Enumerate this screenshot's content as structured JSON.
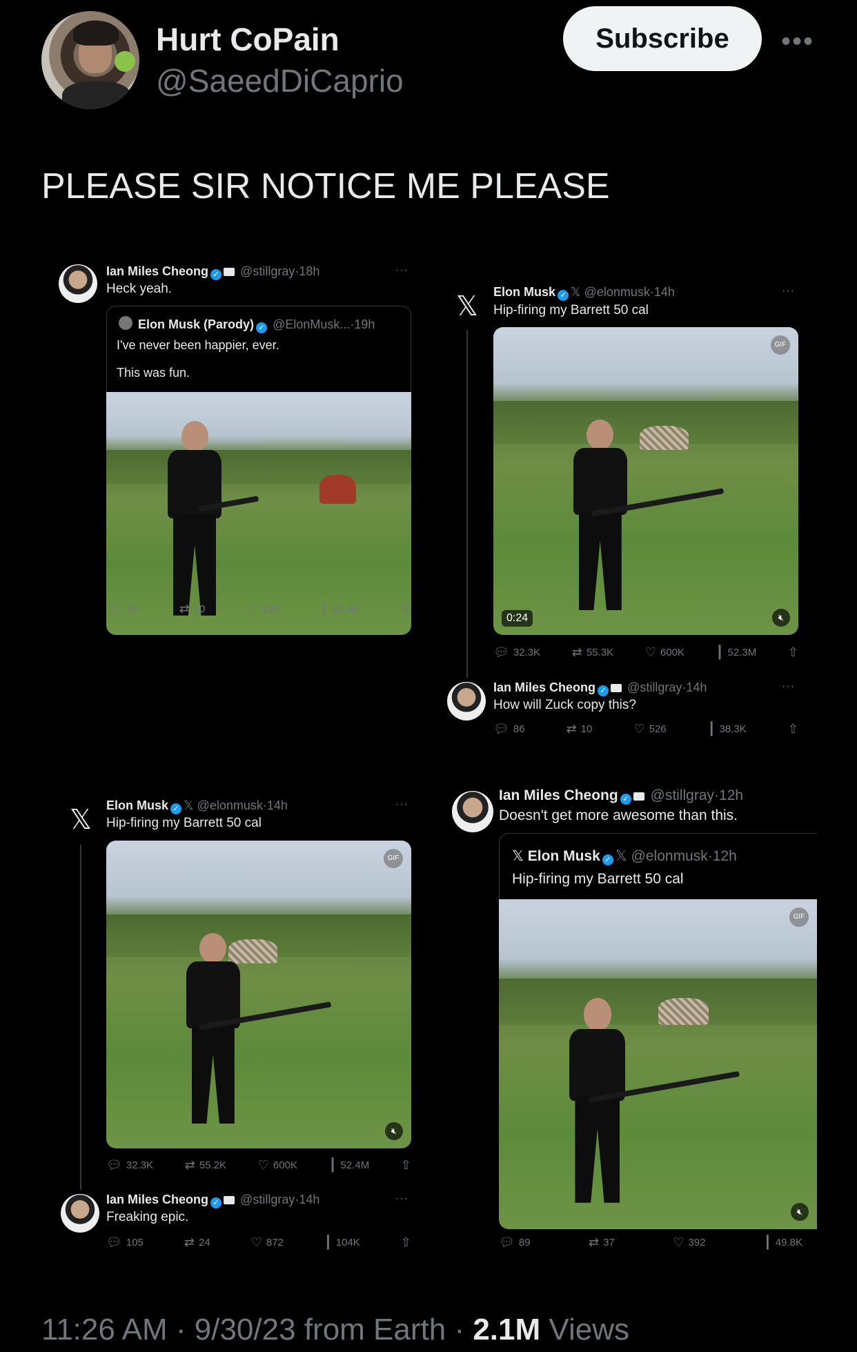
{
  "author": {
    "name": "Hurt CoPain",
    "handle": "@SaeedDiCaprio",
    "subscribe_label": "Subscribe",
    "more_icon": "more-horizontal-icon"
  },
  "tweet_text": "PLEASE SIR NOTICE ME PLEASE",
  "panels": {
    "top_left": {
      "author": "Ian Miles Cheong",
      "handle": "@stillgray",
      "time": "18h",
      "text": "Heck yeah.",
      "quote": {
        "author": "Elon Musk (Parody)",
        "handle": "@ElonMusk...",
        "time": "19h",
        "line1": "I've never been happier, ever.",
        "line2": "This was fun."
      },
      "stats": {
        "replies": "28",
        "reposts": "10",
        "likes": "129",
        "views": "22.4K"
      }
    },
    "top_right": {
      "author": "Elon Musk",
      "handle": "@elonmusk",
      "time": "14h",
      "text": "Hip-firing my Barrett 50 cal",
      "video_time": "0:24",
      "stats": {
        "replies": "32.3K",
        "reposts": "55.3K",
        "likes": "600K",
        "views": "52.3M"
      },
      "reply": {
        "author": "Ian Miles Cheong",
        "handle": "@stillgray",
        "time": "14h",
        "text": "How will Zuck copy this?",
        "stats": {
          "replies": "86",
          "reposts": "10",
          "likes": "526",
          "views": "38.3K"
        }
      }
    },
    "bottom_left": {
      "author": "Elon Musk",
      "handle": "@elonmusk",
      "time": "14h",
      "text": "Hip-firing my Barrett 50 cal",
      "stats": {
        "replies": "32.3K",
        "reposts": "55.2K",
        "likes": "600K",
        "views": "52.4M"
      },
      "reply": {
        "author": "Ian Miles Cheong",
        "handle": "@stillgray",
        "time": "14h",
        "text": "Freaking epic.",
        "stats": {
          "replies": "105",
          "reposts": "24",
          "likes": "872",
          "views": "104K"
        }
      }
    },
    "bottom_right": {
      "author": "Ian Miles Cheong",
      "handle": "@stillgray",
      "time": "12h",
      "text": "Doesn't get more awesome than this.",
      "quote": {
        "author": "Elon Musk",
        "handle": "@elonmusk",
        "time": "12h",
        "text": "Hip-firing my Barrett 50 cal"
      },
      "stats": {
        "replies": "89",
        "reposts": "37",
        "likes": "392",
        "views": "49.8K"
      }
    }
  },
  "footer": {
    "time": "11:26 AM",
    "date": "9/30/23",
    "source": "from Earth",
    "views_count": "2.1M",
    "views_label": "Views",
    "sep": "·"
  }
}
